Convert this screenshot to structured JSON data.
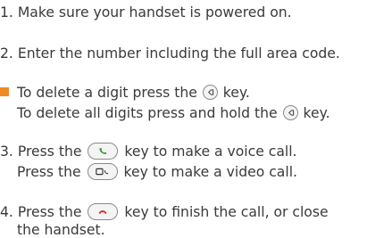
{
  "colors": {
    "text": "#3a3a3a",
    "bullet": "#f08a24",
    "call": "#2e8b2e",
    "end": "#d22a1f"
  },
  "steps": {
    "step1": "1. Make sure your handset is powered on.",
    "step2": "2. Enter the number including the full area code.",
    "tip": {
      "line1_pre": "To delete a digit press the",
      "line1_post": "key.",
      "line2_pre": "To delete all digits press and hold the",
      "line2_post": "key."
    },
    "step3": {
      "line1_pre": "3. Press the",
      "line1_post": "key to make a voice call.",
      "line2_pre": "Press the",
      "line2_post": "key to make a video call."
    },
    "step4": {
      "line1_pre": "4. Press the",
      "line1_post": "key to finish the call, or close",
      "line2": "the handset."
    }
  },
  "icons": {
    "clear_key": "clear-key-icon",
    "call_key": "green-call-key-icon",
    "video_call_key": "video-call-key-icon",
    "end_key": "red-end-key-icon"
  }
}
